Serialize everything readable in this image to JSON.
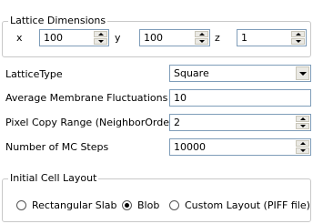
{
  "lattice_dimensions": {
    "title": "Lattice Dimensions",
    "x_label": "x",
    "x_value": "100",
    "y_label": "y",
    "y_value": "100",
    "z_label": "z",
    "z_value": "1"
  },
  "lattice_type": {
    "label": "LatticeType",
    "selected": "Square"
  },
  "membrane_fluctuations": {
    "label": "Average Membrane Fluctuations",
    "value": "10"
  },
  "pixel_copy_range": {
    "label": "Pixel Copy Range (NeighborOrder)",
    "value": "2"
  },
  "mc_steps": {
    "label": "Number of MC Steps",
    "value": "10000"
  },
  "initial_cell_layout": {
    "title": "Initial Cell Layout",
    "options": [
      {
        "label": "Rectangular Slab",
        "selected": false
      },
      {
        "label": "Blob",
        "selected": true
      },
      {
        "label": "Custom Layout (PIFF file)",
        "selected": false
      }
    ]
  }
}
